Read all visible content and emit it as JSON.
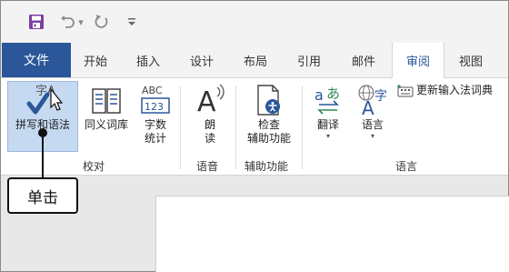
{
  "quick_access": {
    "save_icon": "save-icon",
    "undo_icon": "undo-icon",
    "redo_icon": "redo-icon",
    "customize_icon": "customize-qat-icon"
  },
  "tabs": {
    "file": "文件",
    "items": [
      "开始",
      "插入",
      "设计",
      "布局",
      "引用",
      "邮件",
      "审阅",
      "视图"
    ],
    "active": "审阅"
  },
  "ribbon": {
    "spelling": "拼写和语法",
    "thesaurus": "同义词库",
    "word_count_line1": "字数",
    "word_count_line2": "统计",
    "read_aloud_line1": "朗",
    "read_aloud_line2": "读",
    "accessibility_line1": "检查",
    "accessibility_line2": "辅助功能",
    "translate": "翻译",
    "language": "语言",
    "update_ime": "更新输入法词典",
    "abc": "ABC",
    "num": "123"
  },
  "groups": {
    "proofing": "校对",
    "speech": "语音",
    "accessibility": "辅助功能",
    "language": "语言"
  },
  "callout": {
    "text": "单击"
  },
  "colors": {
    "file_tab": "#2b579a",
    "accent_purple": "#7b3fa0",
    "highlight": "#c5d9f1"
  }
}
